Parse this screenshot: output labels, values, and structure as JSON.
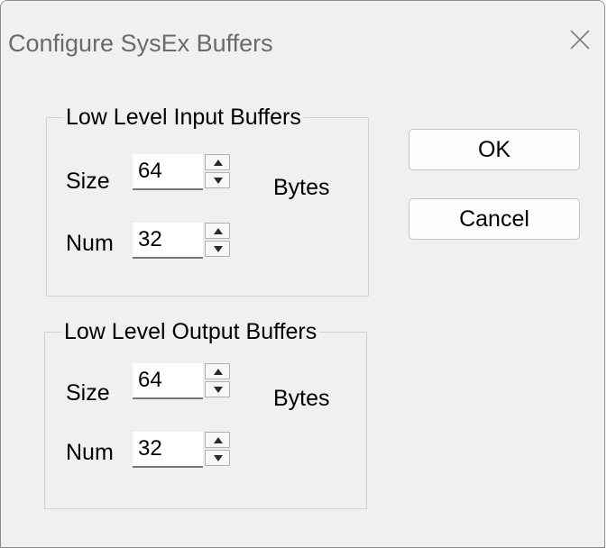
{
  "window": {
    "title": "Configure SysEx Buffers"
  },
  "input_group": {
    "legend": "Low Level Input Buffers",
    "size_label": "Size",
    "size_value": "64",
    "size_unit": "Bytes",
    "num_label": "Num",
    "num_value": "32"
  },
  "output_group": {
    "legend": "Low Level Output Buffers",
    "size_label": "Size",
    "size_value": "64",
    "size_unit": "Bytes",
    "num_label": "Num",
    "num_value": "32"
  },
  "buttons": {
    "ok_label": "OK",
    "cancel_label": "Cancel"
  },
  "icons": {
    "close": "close-icon",
    "spin_up": "arrow-up-icon",
    "spin_down": "arrow-down-icon"
  }
}
